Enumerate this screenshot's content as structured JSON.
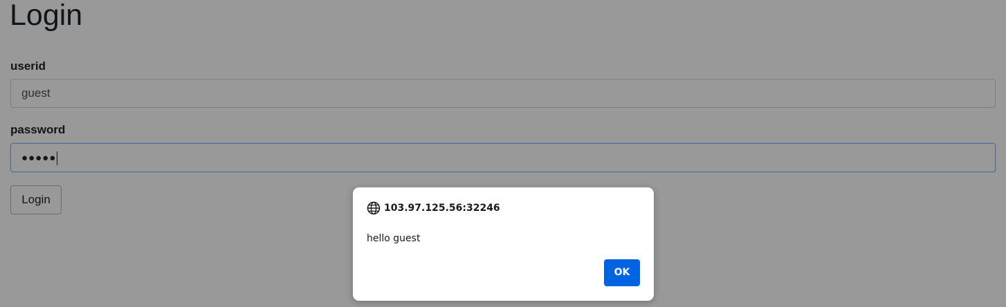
{
  "page": {
    "title": "Login"
  },
  "form": {
    "userid_label": "userid",
    "userid_value": "guest",
    "password_label": "password",
    "password_masked": "●●●●●",
    "submit_label": "Login"
  },
  "dialog": {
    "origin": "103.97.125.56:32246",
    "message": "hello guest",
    "ok_label": "OK",
    "icon": "globe-icon"
  },
  "colors": {
    "ok_button": "#0063e1",
    "focus_border": "#86b7fe",
    "overlay": "rgba(0,0,0,0.40)"
  }
}
